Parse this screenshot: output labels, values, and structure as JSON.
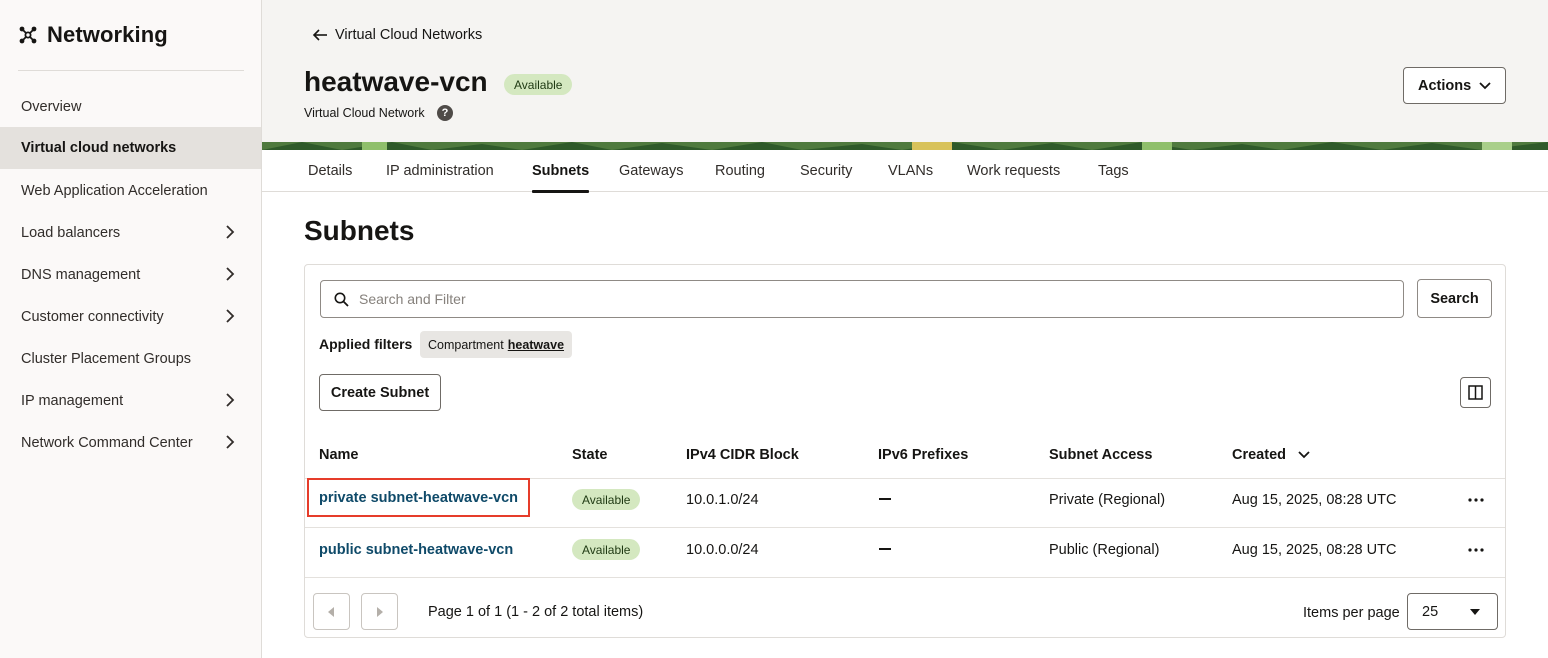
{
  "sidebar": {
    "title": "Networking",
    "icon": "network-icon",
    "items": [
      {
        "label": "Overview",
        "active": false,
        "expandable": false
      },
      {
        "label": "Virtual cloud networks",
        "active": true,
        "expandable": false
      },
      {
        "label": "Web Application Acceleration",
        "active": false,
        "expandable": false
      },
      {
        "label": "Load balancers",
        "active": false,
        "expandable": true
      },
      {
        "label": "DNS management",
        "active": false,
        "expandable": true
      },
      {
        "label": "Customer connectivity",
        "active": false,
        "expandable": true
      },
      {
        "label": "Cluster Placement Groups",
        "active": false,
        "expandable": false
      },
      {
        "label": "IP management",
        "active": false,
        "expandable": true
      },
      {
        "label": "Network Command Center",
        "active": false,
        "expandable": true
      }
    ]
  },
  "header": {
    "back_label": "Virtual Cloud Networks",
    "title": "heatwave-vcn",
    "status": "Available",
    "subtitle": "Virtual Cloud Network",
    "help": "?",
    "actions_label": "Actions"
  },
  "tabs": [
    {
      "label": "Details",
      "active": false
    },
    {
      "label": "IP administration",
      "active": false
    },
    {
      "label": "Subnets",
      "active": true
    },
    {
      "label": "Gateways",
      "active": false
    },
    {
      "label": "Routing",
      "active": false
    },
    {
      "label": "Security",
      "active": false
    },
    {
      "label": "VLANs",
      "active": false
    },
    {
      "label": "Work requests",
      "active": false
    },
    {
      "label": "Tags",
      "active": false
    }
  ],
  "main": {
    "section_title": "Subnets",
    "search": {
      "placeholder": "Search and Filter",
      "button": "Search"
    },
    "applied_filters_label": "Applied filters",
    "filter_chip": {
      "key": "Compartment",
      "value": "heatwave"
    },
    "create_button": "Create Subnet",
    "table": {
      "columns": [
        "Name",
        "State",
        "IPv4 CIDR Block",
        "IPv6 Prefixes",
        "Subnet Access",
        "Created"
      ],
      "rows": [
        {
          "name": "private subnet-heatwave-vcn",
          "state": "Available",
          "ipv4": "10.0.1.0/24",
          "ipv6": "—",
          "access": "Private (Regional)",
          "created": "Aug 15, 2025, 08:28 UTC",
          "highlighted": true
        },
        {
          "name": "public subnet-heatwave-vcn",
          "state": "Available",
          "ipv4": "10.0.0.0/24",
          "ipv6": "—",
          "access": "Public (Regional)",
          "created": "Aug 15, 2025, 08:28 UTC",
          "highlighted": false
        }
      ]
    },
    "pagination": {
      "text": "Page 1 of 1 (1 - 2 of 2 total items)",
      "items_per_page_label": "Items per page",
      "items_per_page": "25"
    }
  },
  "colors": {
    "status_badge_bg": "#d4e8c0",
    "link": "#0f4a69",
    "highlight": "#e63c2a",
    "sidebar_active_bg": "#e4e1dd"
  }
}
